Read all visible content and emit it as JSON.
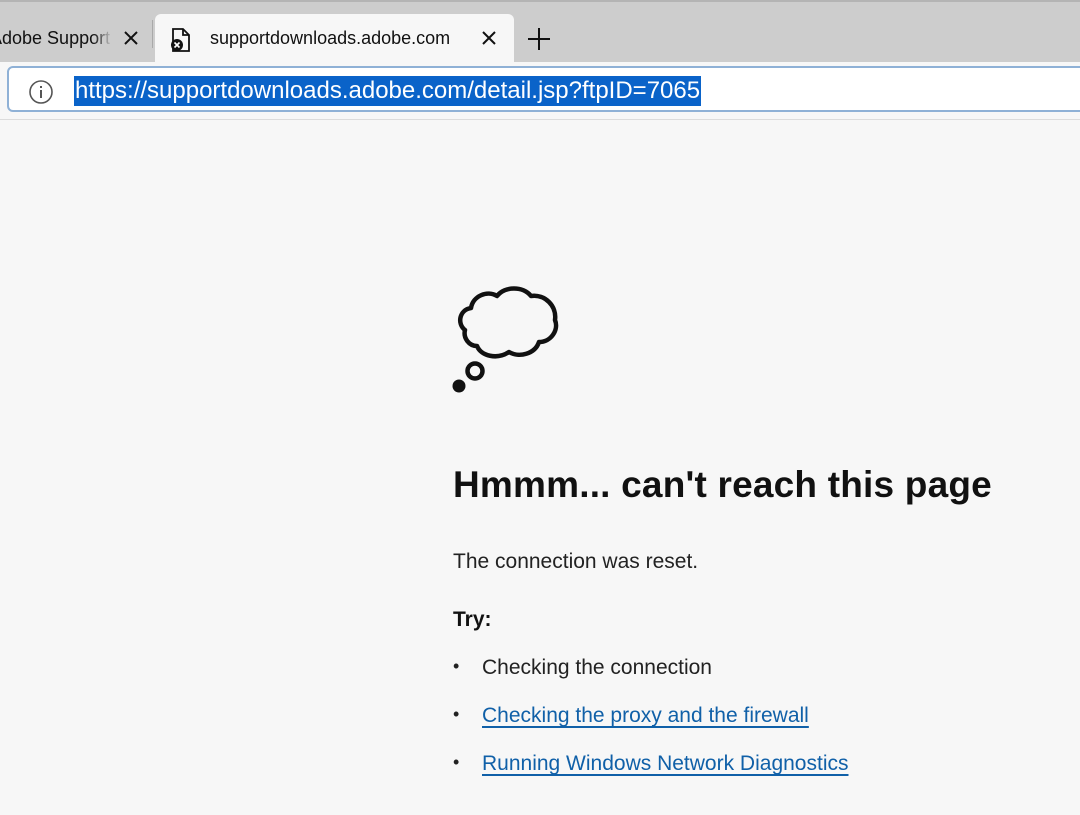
{
  "tabs": [
    {
      "title": "Adobe Support C",
      "active": false
    },
    {
      "title": "supportdownloads.adobe.com",
      "active": true
    }
  ],
  "address_bar": {
    "url": "https://supportdownloads.adobe.com/detail.jsp?ftpID=7065",
    "selected": true
  },
  "error_page": {
    "icon": "thought-bubble-icon",
    "heading": "Hmmm... can't reach this page",
    "message": "The connection was reset.",
    "try_label": "Try:",
    "suggestions": [
      {
        "text": "Checking the connection",
        "is_link": false
      },
      {
        "text": "Checking the proxy and the firewall",
        "is_link": true
      },
      {
        "text": "Running Windows Network Diagnostics",
        "is_link": true
      }
    ]
  },
  "colors": {
    "selection": "#0a63c9",
    "link": "#1060a8",
    "page_background": "#f7f7f7",
    "tabstrip_background": "#cdcdcd"
  }
}
